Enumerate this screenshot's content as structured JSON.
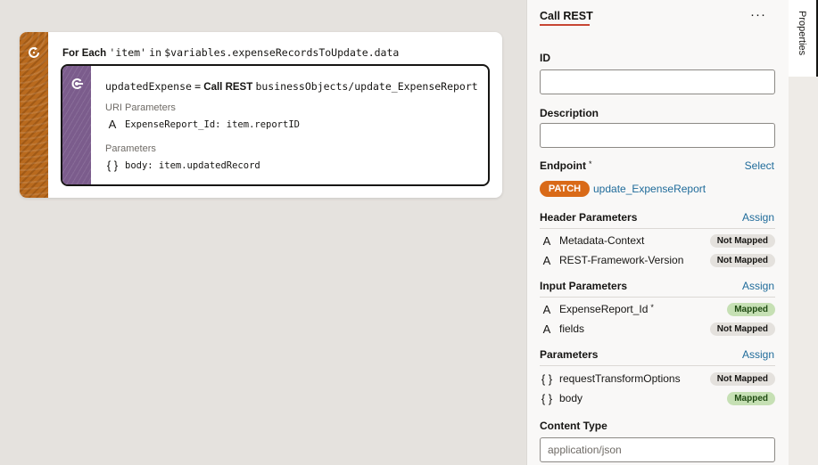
{
  "canvas": {
    "foreach": {
      "keyword": "For Each",
      "item": "'item'",
      "in_keyword": "in",
      "source": "$variables.expenseRecordsToUpdate.data"
    },
    "callrest": {
      "assign_var": "updatedExpense",
      "equals": "=",
      "action_name": "Call REST",
      "endpoint": "businessObjects/update_ExpenseReport",
      "uri_section": "URI Parameters",
      "uri_param": "ExpenseReport_Id: item.reportID",
      "params_section": "Parameters",
      "param": "body: item.updatedRecord"
    }
  },
  "properties": {
    "title": "Call REST",
    "more": "···",
    "id_label": "ID",
    "id_value": "",
    "description_label": "Description",
    "description_value": "",
    "endpoint_label": "Endpoint",
    "required_mark": "*",
    "endpoint_select": "Select",
    "method": "PATCH",
    "endpoint_name": "update_ExpenseReport",
    "header_params": {
      "label": "Header Parameters",
      "action": "Assign",
      "rows": [
        {
          "icon": "A",
          "name": "Metadata-Context",
          "status": "Not Mapped"
        },
        {
          "icon": "A",
          "name": "REST-Framework-Version",
          "status": "Not Mapped"
        }
      ]
    },
    "input_params": {
      "label": "Input Parameters",
      "action": "Assign",
      "rows": [
        {
          "icon": "A",
          "name": "ExpenseReport_Id",
          "required": "*",
          "status": "Mapped"
        },
        {
          "icon": "A",
          "name": "fields",
          "status": "Not Mapped"
        }
      ]
    },
    "parameters": {
      "label": "Parameters",
      "action": "Assign",
      "rows": [
        {
          "icon": "{ }",
          "name": "requestTransformOptions",
          "status": "Not Mapped"
        },
        {
          "icon": "{ }",
          "name": "body",
          "status": "Mapped"
        }
      ]
    },
    "content_type_label": "Content Type",
    "content_type_placeholder": "application/json"
  },
  "side_tabs": {
    "properties": "Properties"
  },
  "colors": {
    "accent_underline": "#c74634",
    "patch_badge": "#d96a18",
    "link": "#1f6b9a",
    "mapped_badge": "#c6e0b4",
    "not_mapped_badge": "#e4e1dd",
    "foreach_strip": "#b96a1e",
    "callrest_strip": "#7b5c8c"
  }
}
